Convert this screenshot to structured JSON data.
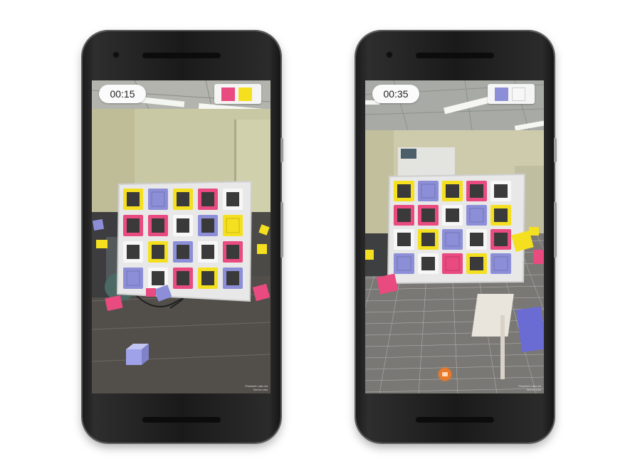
{
  "colors": {
    "pink": "#e94a7f",
    "yellow": "#f4e01f",
    "purple": "#8c8fd8",
    "white": "#f7f7f7",
    "rec": "#ea7a2a"
  },
  "phones": [
    {
      "timer": "00:15",
      "target_colors": [
        "#e94a7f",
        "#f4e01f"
      ],
      "watermark_line1": "Pinwheel Labs Ad",
      "watermark_line2": "Not for Use",
      "grid": [
        [
          "yellow",
          "purple",
          "yellow",
          "pink",
          "white"
        ],
        [
          "pink",
          "pink",
          "white",
          "purple",
          "yellow"
        ],
        [
          "white",
          "yellow",
          "purple",
          "white",
          "pink"
        ],
        [
          "purple",
          "white",
          "pink",
          "yellow",
          "purple"
        ]
      ],
      "filled_slots": [
        [
          0,
          1
        ],
        [
          1,
          4
        ],
        [
          3,
          0
        ]
      ]
    },
    {
      "timer": "00:35",
      "target_colors": [
        "#8c8fd8",
        "#f7f7f7"
      ],
      "watermark_line1": "Pinwheel Labs Ad",
      "watermark_line2": "Not for Use",
      "grid": [
        [
          "yellow",
          "purple",
          "yellow",
          "pink",
          "white"
        ],
        [
          "pink",
          "pink",
          "white",
          "purple",
          "yellow"
        ],
        [
          "white",
          "yellow",
          "purple",
          "white",
          "pink"
        ],
        [
          "purple",
          "white",
          "pink",
          "yellow",
          "purple"
        ]
      ],
      "filled_slots": [
        [
          0,
          1
        ],
        [
          1,
          3
        ],
        [
          2,
          2
        ],
        [
          3,
          0
        ],
        [
          3,
          2
        ],
        [
          3,
          4
        ]
      ]
    }
  ]
}
